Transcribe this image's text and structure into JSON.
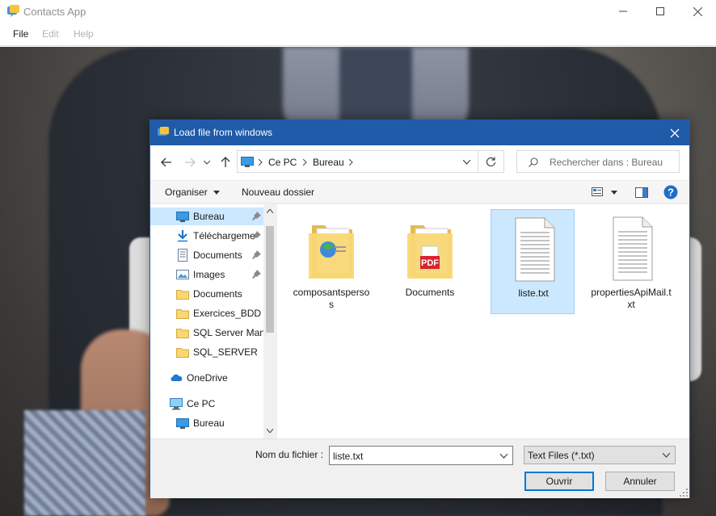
{
  "app": {
    "title": "Contacts App",
    "menu": [
      "File",
      "Edit",
      "Help"
    ]
  },
  "dialog": {
    "title": "Load file from windows",
    "breadcrumb": [
      "Ce PC",
      "Bureau"
    ],
    "search_placeholder": "Rechercher dans : Bureau",
    "toolbar": {
      "organise_label": "Organiser",
      "new_folder_label": "Nouveau dossier"
    },
    "nav_items": [
      {
        "label": "Bureau",
        "icon": "desktop-icon",
        "pinned": true,
        "selected": true
      },
      {
        "label": "Téléchargeme",
        "icon": "download-icon",
        "pinned": true
      },
      {
        "label": "Documents",
        "icon": "document-icon",
        "pinned": true
      },
      {
        "label": "Images",
        "icon": "image-icon",
        "pinned": true
      },
      {
        "label": "Documents",
        "icon": "folder-icon"
      },
      {
        "label": "Exercices_BDD",
        "icon": "folder-icon"
      },
      {
        "label": "SQL Server Mana",
        "icon": "folder-icon"
      },
      {
        "label": "SQL_SERVER",
        "icon": "folder-icon"
      },
      {
        "label": "OneDrive",
        "icon": "onedrive-icon"
      },
      {
        "label": "Ce PC",
        "icon": "computer-icon"
      },
      {
        "label": "Bureau",
        "icon": "desktop-icon"
      }
    ],
    "files": [
      {
        "name": "composantspersos",
        "type": "folder",
        "icon": "folder-web-icon"
      },
      {
        "name": "Documents",
        "type": "folder",
        "icon": "folder-pdf-icon"
      },
      {
        "name": "liste.txt",
        "type": "text",
        "icon": "text-file-icon",
        "selected": true
      },
      {
        "name": "propertiesApiMail.txt",
        "type": "text",
        "icon": "text-file-icon"
      }
    ],
    "filename_label": "Nom du fichier :",
    "filename_value": "liste.txt",
    "filter_value": "Text Files (*.txt)",
    "open_label": "Ouvrir",
    "cancel_label": "Annuler"
  },
  "colors": {
    "dialog_title_bar": "#1f5ba8",
    "selection": "#cce8ff",
    "accent": "#0078d7"
  }
}
